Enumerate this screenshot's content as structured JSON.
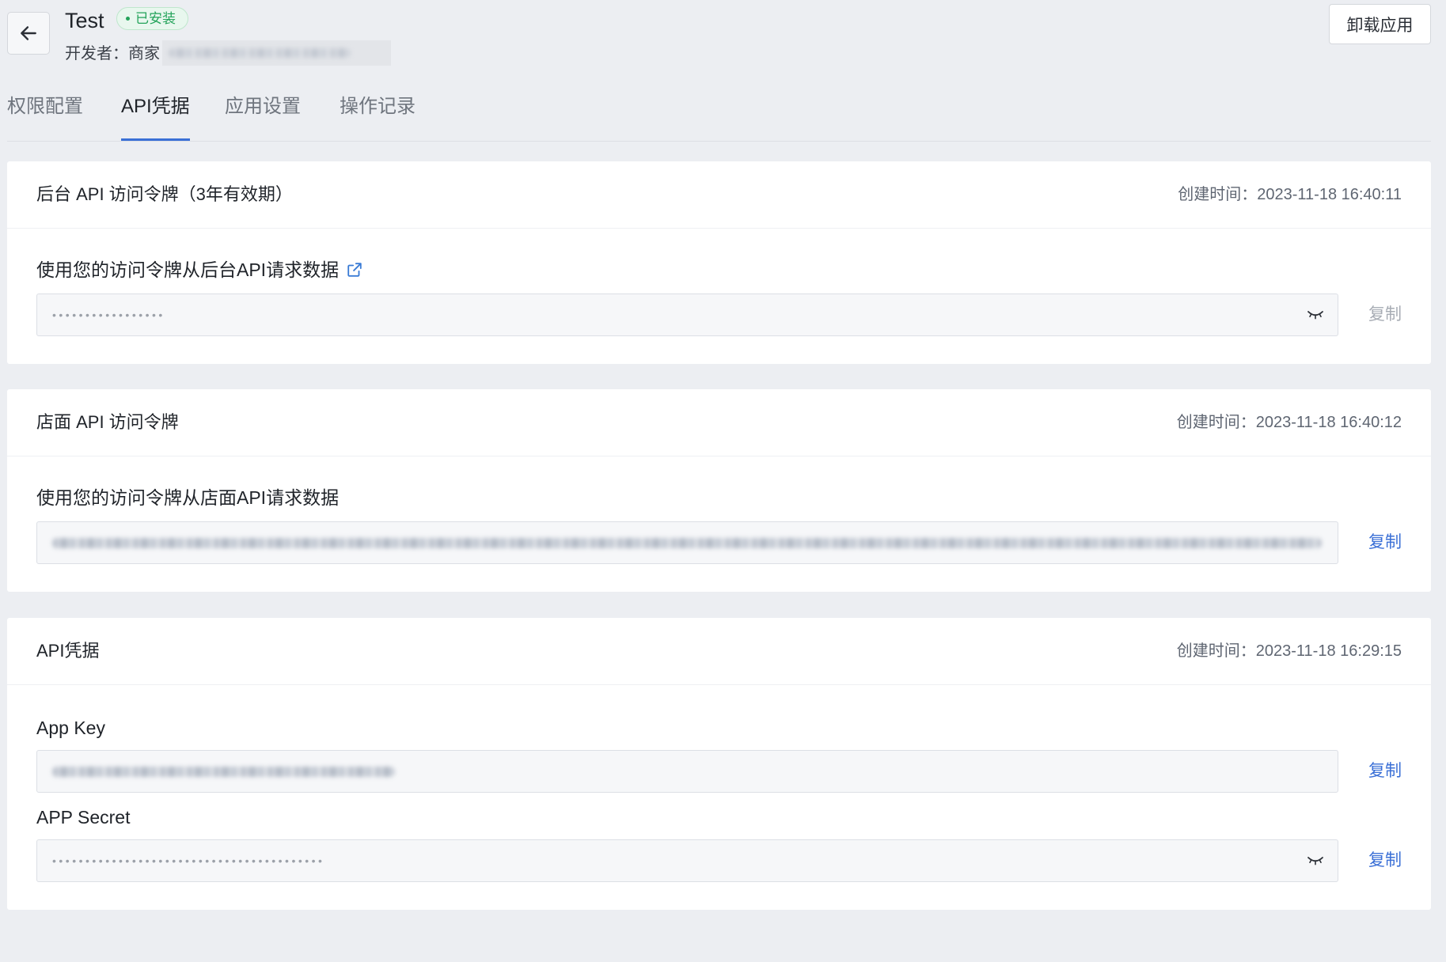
{
  "header": {
    "app_name": "Test",
    "status_badge": "已安装",
    "developer_label": "开发者：商家",
    "uninstall_button": "卸载应用"
  },
  "tabs": [
    {
      "label": "权限配置",
      "active": false
    },
    {
      "label": "API凭据",
      "active": true
    },
    {
      "label": "应用设置",
      "active": false
    },
    {
      "label": "操作记录",
      "active": false
    }
  ],
  "admin_api_token": {
    "title": "后台 API 访问令牌（3年有效期）",
    "created_label": "创建时间：",
    "created_time": "2023-11-18 16:40:11",
    "description": "使用您的访问令牌从后台API请求数据",
    "masked_value": "•••••••••••••••••",
    "copy_label": "复制",
    "copy_disabled": true
  },
  "storefront_api_token": {
    "title": "店面 API 访问令牌",
    "created_label": "创建时间：",
    "created_time": "2023-11-18 16:40:12",
    "description": "使用您的访问令牌从店面API请求数据",
    "copy_label": "复制",
    "copy_disabled": false
  },
  "api_credentials": {
    "title": "API凭据",
    "created_label": "创建时间：",
    "created_time": "2023-11-18 16:29:15",
    "app_key_label": "App Key",
    "app_key_copy_label": "复制",
    "app_secret_label": "APP Secret",
    "app_secret_masked_value": "•••••••••••••••••••••••••••••••••••••••••",
    "app_secret_copy_label": "复制"
  },
  "icons": {
    "back": "arrow-left-icon",
    "external_link": "external-link-icon",
    "reveal_toggle": "eye-closed-icon",
    "status": "status-dot"
  },
  "colors": {
    "page_background": "#eceef2",
    "card_background": "#ffffff",
    "text_primary": "#1f2329",
    "text_secondary": "#5f6672",
    "tab_inactive": "#6f757e",
    "accent": "#3a6fd6",
    "copy_disabled": "#a7acb4",
    "badge_text": "#23a35a",
    "badge_background": "#e8f7ee",
    "input_background": "#f6f7f9"
  }
}
